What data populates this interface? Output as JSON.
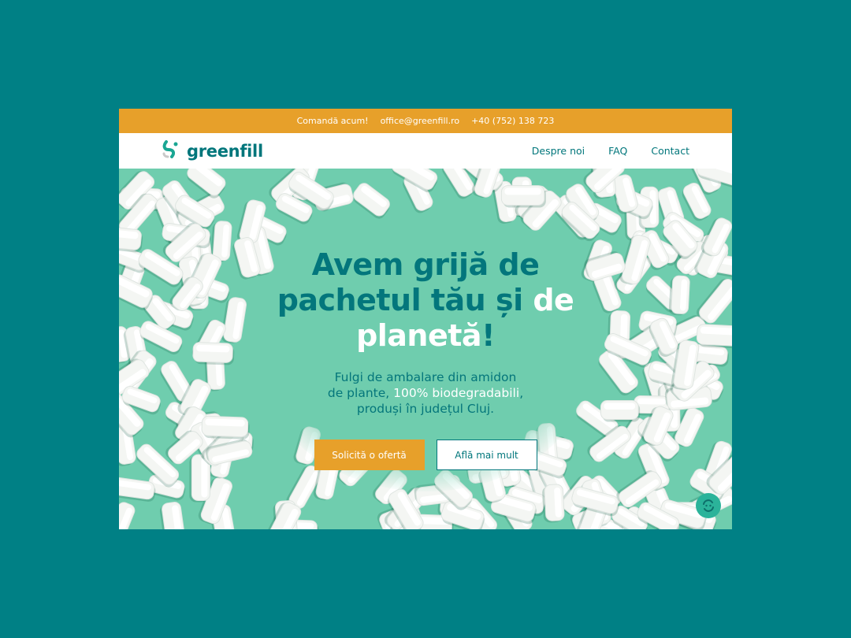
{
  "topbar": {
    "cta": "Comandă acum!",
    "email": "office@greenfill.ro",
    "phone": "+40 (752) 138 723"
  },
  "nav": {
    "brand": "greenfill",
    "links": [
      "Despre noi",
      "FAQ",
      "Contact"
    ]
  },
  "hero": {
    "headline_line1": "Avem grijă de",
    "headline_line2_a": "pachetul tău și",
    "headline_line2_b": "de",
    "headline_line3_a": "planetă",
    "headline_line3_b": "!",
    "sub_line1": "Fulgi de ambalare din amidon",
    "sub_line2_a": "de plante,",
    "sub_line2_b": "100% biodegradabili",
    "sub_line2_c": ",",
    "sub_line3": "produși în județul Cluj.",
    "primary_button": "Solicită o ofertă",
    "secondary_button": "Află mai mult"
  },
  "icons": {
    "logo": "greenfill-logo-icon",
    "badge": "recycle-badge-icon"
  },
  "colors": {
    "page_background": "#008085",
    "accent_orange": "#e7a02a",
    "brand_teal": "#00767b",
    "hero_green": "#6fcdae"
  }
}
